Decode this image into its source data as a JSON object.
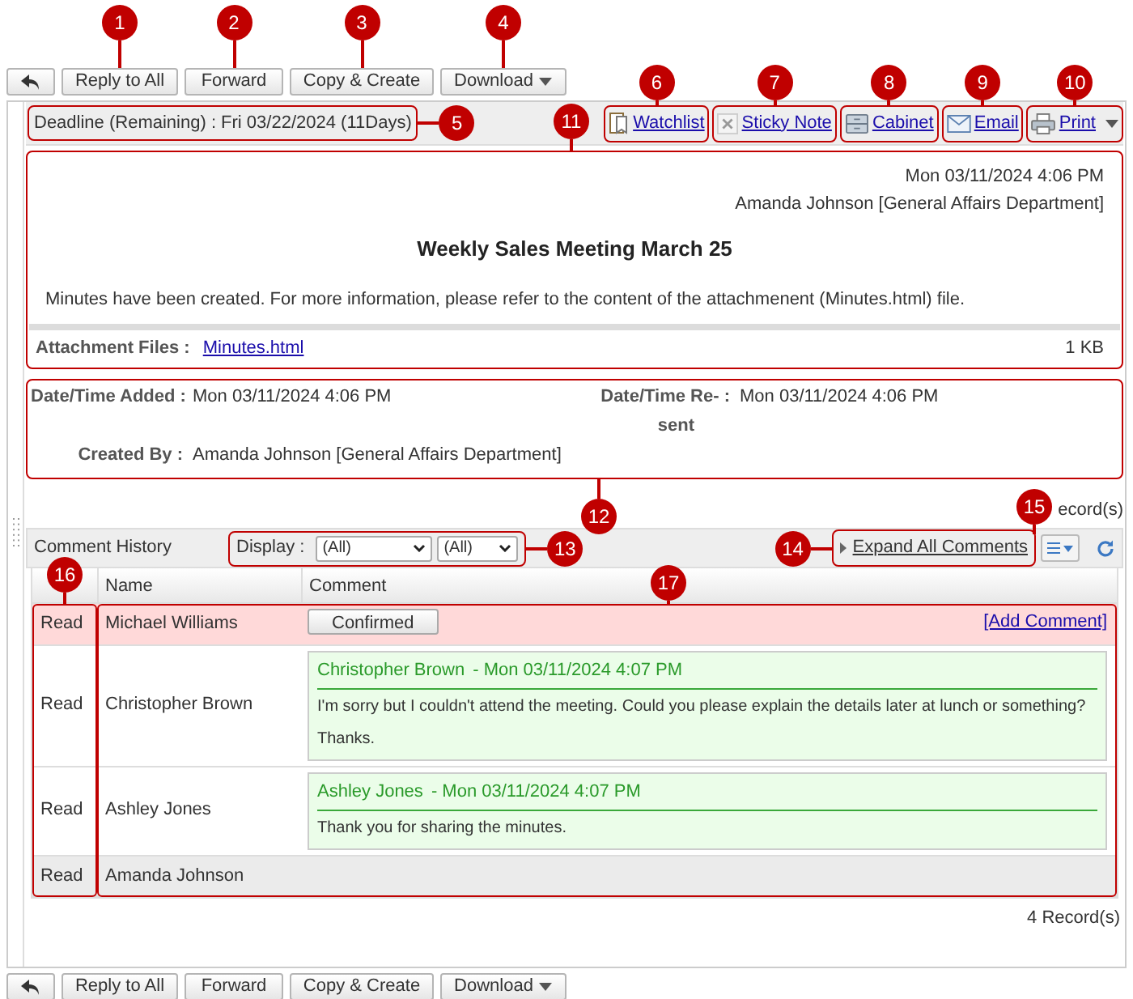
{
  "toolbar_top": [
    {
      "label": "Reply to All",
      "kind": "button"
    },
    {
      "label": "Forward",
      "kind": "button"
    },
    {
      "label": "Copy & Create",
      "kind": "button"
    },
    {
      "label": "Download",
      "kind": "dropdown"
    }
  ],
  "deadline": "Deadline (Remaining) : Fri 03/22/2024 (11Days)",
  "actions": [
    {
      "label": "Watchlist",
      "kind": "watchlist"
    },
    {
      "label": "Sticky Note",
      "kind": "note"
    },
    {
      "label": "Cabinet",
      "kind": "cabinet"
    },
    {
      "label": "Email",
      "kind": "mail"
    },
    {
      "label": "Print",
      "kind": "print"
    }
  ],
  "message": {
    "date": "Mon 03/11/2024 4:06 PM",
    "sender": "Amanda Johnson [General Affairs Department]",
    "title": "Weekly Sales Meeting March 25",
    "body": "Minutes have been created. For more information, please refer to the content of the attachmenent (Minutes.html) file.",
    "attachments_label": "Attachment Files :",
    "attachment_name": "Minutes.html",
    "attachment_size": "1 KB"
  },
  "details": {
    "added_label": "Date/Time Added :",
    "added_value": "Mon 03/11/2024 4:06 PM",
    "resent_label": "Date/Time Re- :",
    "resent_label_rest": "sent",
    "resent_value": "Mon 03/11/2024 4:06 PM",
    "created_label": "Created By :",
    "created_value": "Amanda Johnson [General Affairs Department]"
  },
  "record_count_top": "ecord(s)",
  "comments": {
    "title": "Comment History",
    "display_label": "Display :",
    "filters": [
      {
        "value": "(All)"
      },
      {
        "value": "(All)"
      }
    ],
    "expand": "Expand All Comments",
    "columns": [
      "Name",
      "Comment"
    ],
    "rows": [
      {
        "kind": "confirm",
        "status": "Read",
        "name": "Michael Williams",
        "button": "Confirmed",
        "link": "[Add Comment]"
      },
      {
        "kind": "comment",
        "status": "Read",
        "name": "Christopher Brown",
        "author": "Christopher Brown",
        "time": "- Mon 03/11/2024 4:07 PM",
        "text": "I'm sorry but I couldn't attend the meeting. Could you please explain the details later at lunch or something? Thanks."
      },
      {
        "kind": "comment",
        "status": "Read",
        "name": "Ashley Jones",
        "author": "Ashley Jones",
        "time": "- Mon 03/11/2024 4:07 PM",
        "text": "Thank you for sharing the minutes."
      },
      {
        "kind": "sender",
        "status": "Read",
        "name": "Amanda Johnson"
      }
    ]
  },
  "record_count_bottom": "4 Record(s)",
  "toolbar_bottom": [
    {
      "label": "Reply to All",
      "kind": "button"
    },
    {
      "label": "Forward",
      "kind": "button"
    },
    {
      "label": "Copy & Create",
      "kind": "button"
    },
    {
      "label": "Download",
      "kind": "dropdown"
    }
  ],
  "callouts": [
    "1",
    "2",
    "3",
    "4",
    "5",
    "6",
    "7",
    "8",
    "9",
    "10",
    "11",
    "12",
    "13",
    "14",
    "15",
    "16",
    "17"
  ]
}
